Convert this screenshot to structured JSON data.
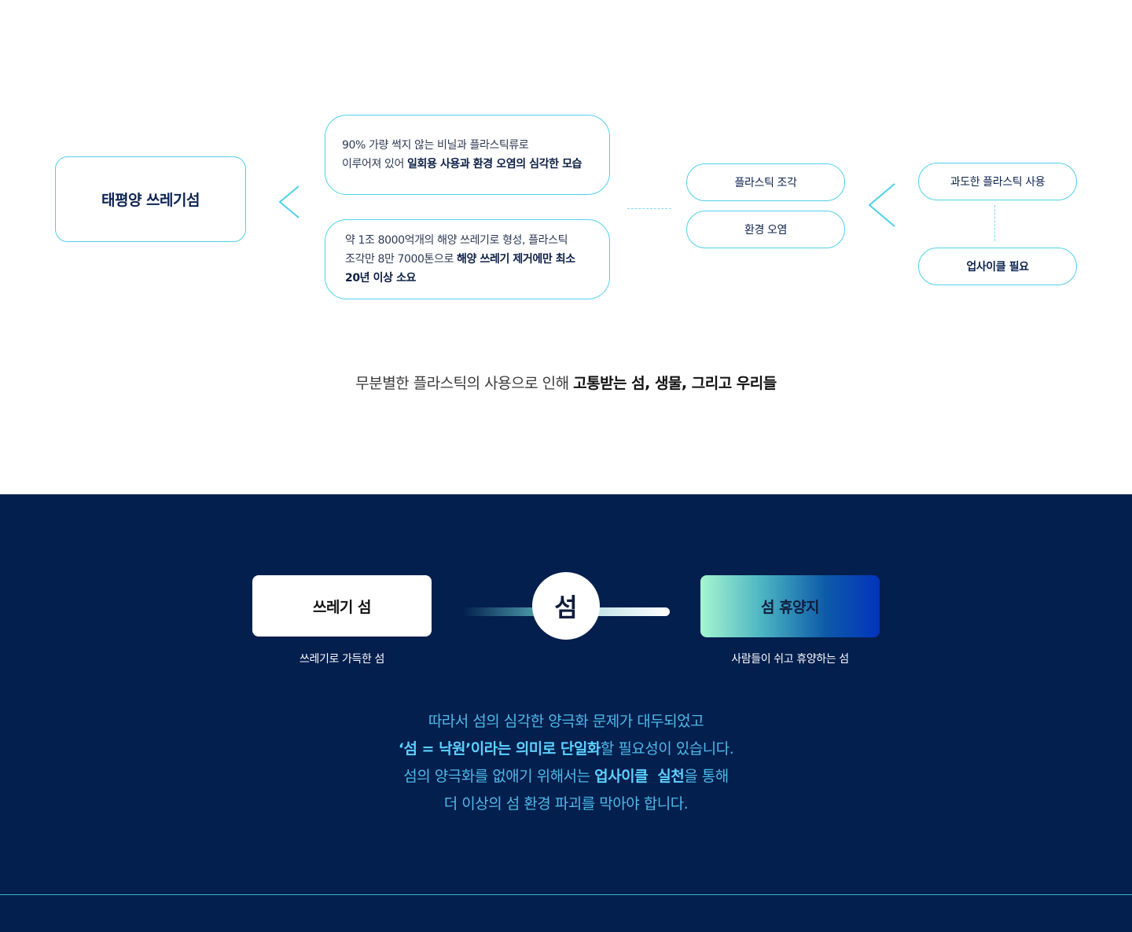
{
  "flow": {
    "main_label": "태평양 쓰레기섬",
    "desc1": {
      "line1": "90% 가량 썩지 않는 비닐과 플라스틱류로",
      "line2_plain": "이루어져 있어 ",
      "line2_bold": "일회용 사용과 환경 오염의 심각한 모습"
    },
    "desc2": {
      "line1": "약 1조 8000억개의 해양 쓰레기로 형성, 플라스틱",
      "line2_plain": "조각만 8만 7000톤으로 ",
      "line2_bold": "해양 쓰레기 제거에만 최소",
      "line3_bold": "20년 이상 소요"
    },
    "cause1": "플라스틱 조각",
    "cause2": "환경 오염",
    "root1": "과도한 플라스틱 사용",
    "root2": "업사이클 필요",
    "accent_color": "#4fd0ea"
  },
  "tagline": {
    "plain": "무분별한 플라스틱의 사용으로 인해 ",
    "bold": "고통받는 섬, 생물, 그리고 우리들"
  },
  "compare": {
    "left_label": "쓰레기 섬",
    "left_caption": "쓰레기로 가득한 섬",
    "center_label": "섬",
    "right_label": "섬 휴양지",
    "right_caption": "사람들이 쉬고 휴양하는 섬",
    "background_color": "#021f4e"
  },
  "statement": {
    "line1": "따라서 섬의 심각한 양극화 문제가 대두되었고",
    "line2_bold": "‘섬 = 낙원’이라는 의미로 단일화",
    "line2_plain": "할 필요성이 있습니다.",
    "line3_plain_a": "섬의 양극화를 없애기 위해서는 ",
    "line3_bold": "업사이클  실천",
    "line3_plain_b": "을 통해",
    "line4": "더 이상의 섬 환경 파괴를 막아야 합니다."
  }
}
